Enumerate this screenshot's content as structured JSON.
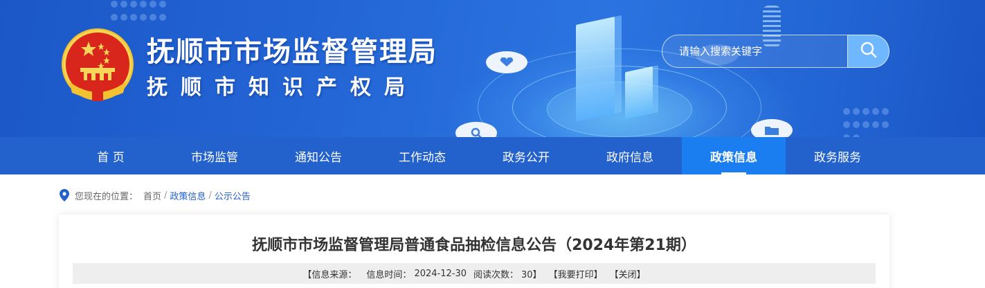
{
  "header": {
    "title": "抚顺市市场监督管理局",
    "subtitle": "抚顺市知识产权局",
    "emblem_icon": "national-emblem-icon"
  },
  "search": {
    "placeholder": "请输入搜索关键字",
    "button_icon": "search-icon"
  },
  "nav": {
    "items": [
      {
        "label": "首 页"
      },
      {
        "label": "市场监管"
      },
      {
        "label": "通知公告"
      },
      {
        "label": "工作动态"
      },
      {
        "label": "政务公开"
      },
      {
        "label": "政府信息"
      },
      {
        "label": "政策信息",
        "active": true
      },
      {
        "label": "政务服务"
      }
    ]
  },
  "breadcrumb": {
    "prefix": "您现在的位置：",
    "items": [
      "首页",
      "政策信息",
      "公示公告"
    ],
    "separator": "/"
  },
  "article": {
    "title": "抚顺市市场监督管理局普通食品抽检信息公告（2024年第21期）",
    "meta": {
      "source_label": "【信息来源：",
      "time_label": "信息时间：",
      "time_value": "2024-12-30",
      "reads_label": "阅读次数：",
      "reads_value": "30】",
      "print": "【我要打印】",
      "close": "【关闭】"
    }
  },
  "colors": {
    "banner": "#2466d6",
    "nav": "#2361cc",
    "nav_active": "#1a7df0",
    "search_button": "#6fb7ff",
    "breadcrumb_link": "#2361cc"
  }
}
